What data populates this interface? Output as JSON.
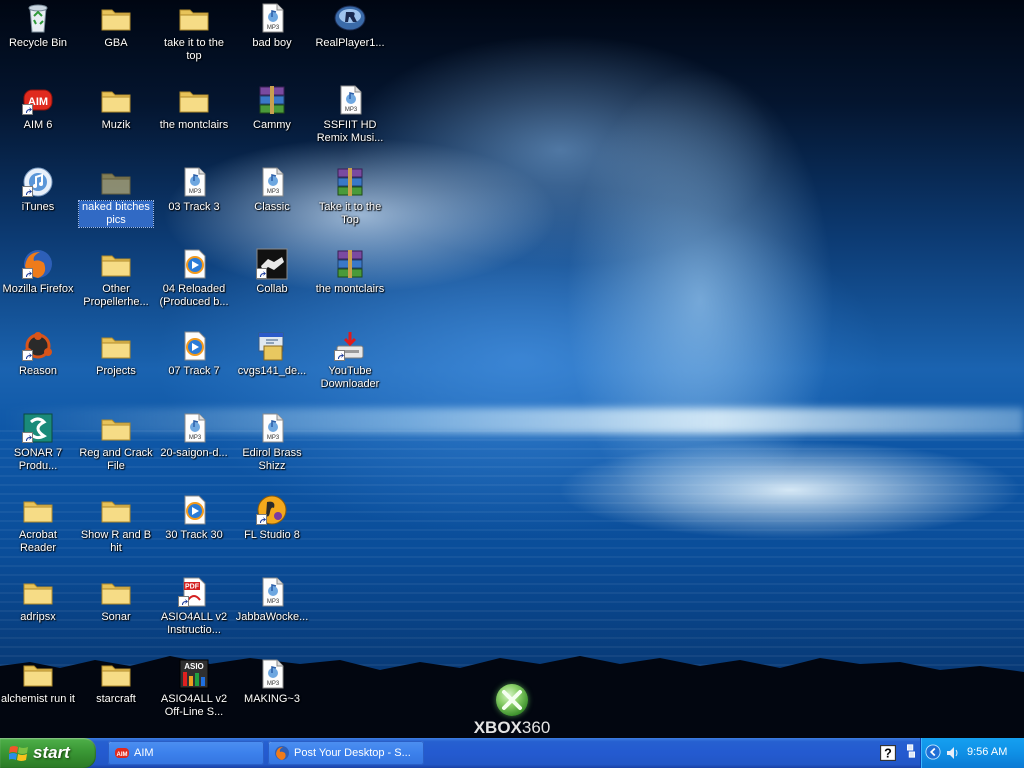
{
  "desktop": {
    "icons": [
      {
        "label": "Recycle Bin",
        "icon": "recycle-bin-icon"
      },
      {
        "label": "AIM 6",
        "icon": "aim-icon"
      },
      {
        "label": "iTunes",
        "icon": "itunes-icon"
      },
      {
        "label": "Mozilla Firefox",
        "icon": "firefox-icon"
      },
      {
        "label": "Reason",
        "icon": "reason-icon"
      },
      {
        "label": "SONAR 7 Produ...",
        "icon": "sonar-icon"
      },
      {
        "label": "Acrobat Reader",
        "icon": "folder-icon"
      },
      {
        "label": "adripsx",
        "icon": "folder-icon"
      },
      {
        "label": "alchemist run it",
        "icon": "folder-icon"
      },
      {
        "label": "GBA",
        "icon": "folder-icon"
      },
      {
        "label": "Muzik",
        "icon": "folder-icon"
      },
      {
        "label": "naked bitches pics",
        "icon": "folder-icon",
        "selected": true
      },
      {
        "label": "Other Propellerhe...",
        "icon": "folder-icon"
      },
      {
        "label": "Projects",
        "icon": "folder-icon"
      },
      {
        "label": "Reg and Crack File",
        "icon": "folder-icon"
      },
      {
        "label": "Show R and B hit",
        "icon": "folder-icon"
      },
      {
        "label": "Sonar",
        "icon": "folder-icon"
      },
      {
        "label": "starcraft",
        "icon": "folder-icon"
      },
      {
        "label": "take it to the top",
        "icon": "folder-icon"
      },
      {
        "label": "the montclairs",
        "icon": "folder-icon"
      },
      {
        "label": "03 Track 3",
        "icon": "mp3-icon"
      },
      {
        "label": "04 Reloaded (Produced b...",
        "icon": "media-player-icon"
      },
      {
        "label": "07 Track 7",
        "icon": "media-player-icon"
      },
      {
        "label": "20-saigon-d...",
        "icon": "mp3-icon"
      },
      {
        "label": "30 Track 30",
        "icon": "media-player-icon"
      },
      {
        "label": "ASIO4ALL v2 Instructio...",
        "icon": "pdf-icon"
      },
      {
        "label": "ASIO4ALL v2 Off-Line S...",
        "icon": "asio-icon"
      },
      {
        "label": "bad boy",
        "icon": "mp3-icon"
      },
      {
        "label": "Cammy",
        "icon": "winrar-icon"
      },
      {
        "label": "Classic",
        "icon": "mp3-icon"
      },
      {
        "label": "Collab",
        "icon": "collab-icon"
      },
      {
        "label": "cvgs141_de...",
        "icon": "installer-icon"
      },
      {
        "label": "Edirol Brass Shizz",
        "icon": "mp3-icon"
      },
      {
        "label": "FL Studio 8",
        "icon": "fl-studio-icon"
      },
      {
        "label": "JabbaWocke...",
        "icon": "mp3-icon"
      },
      {
        "label": "MAKING~3",
        "icon": "mp3-icon"
      },
      {
        "label": "RealPlayer1...",
        "icon": "realplayer-icon"
      },
      {
        "label": "SSFIIT HD Remix Musi...",
        "icon": "mp3-icon"
      },
      {
        "label": "Take it to the Top",
        "icon": "winrar-icon"
      },
      {
        "label": "the montclairs",
        "icon": "winrar-icon"
      },
      {
        "label": "YouTube Downloader",
        "icon": "youtube-downloader-icon"
      }
    ]
  },
  "wallpaper": {
    "logo_x": "XBOX",
    "logo_360": "360"
  },
  "taskbar": {
    "start_label": "start",
    "tasks": [
      {
        "label": "AIM",
        "icon": "aim-icon"
      },
      {
        "label": "Post Your Desktop - S...",
        "icon": "firefox-icon"
      }
    ],
    "tray": {
      "icons": [
        "help-icon",
        "network-icon",
        "expand-arrow-icon",
        "speaker-icon"
      ],
      "clock": "9:56 AM"
    },
    "colors": {
      "taskbar": "#245ad0",
      "start": "#3c9a37",
      "tray": "#0f90e6"
    }
  }
}
